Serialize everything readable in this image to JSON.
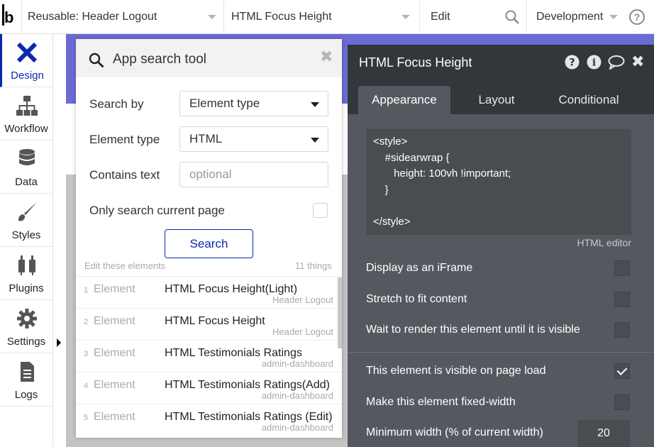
{
  "topbar": {
    "page_selector": "Reusable: Header Logout",
    "element_selector": "HTML Focus Height",
    "mode": "Edit",
    "environment": "Development"
  },
  "sidebar": {
    "items": [
      {
        "label": "Design",
        "icon": "design-icon"
      },
      {
        "label": "Workflow",
        "icon": "workflow-icon"
      },
      {
        "label": "Data",
        "icon": "database-icon"
      },
      {
        "label": "Styles",
        "icon": "brush-icon"
      },
      {
        "label": "Plugins",
        "icon": "plug-icon"
      },
      {
        "label": "Settings",
        "icon": "gear-icon"
      },
      {
        "label": "Logs",
        "icon": "document-icon"
      }
    ]
  },
  "search_tool": {
    "title": "App search tool",
    "search_by_label": "Search by",
    "search_by_value": "Element type",
    "element_type_label": "Element type",
    "element_type_value": "HTML",
    "contains_text_label": "Contains text",
    "contains_text_placeholder": "optional",
    "only_current_label": "Only search current page",
    "search_button": "Search",
    "edit_these": "Edit these elements",
    "count": "11 things",
    "results": [
      {
        "num": "1",
        "kind": "Element",
        "name": "HTML Focus Height(Light)",
        "page": "Header Logout"
      },
      {
        "num": "2",
        "kind": "Element",
        "name": "HTML Focus Height",
        "page": "Header Logout"
      },
      {
        "num": "3",
        "kind": "Element",
        "name": "HTML Testimonials Ratings",
        "page": "admin-dashboard"
      },
      {
        "num": "4",
        "kind": "Element",
        "name": "HTML Testimonials Ratings(Add)",
        "page": "admin-dashboard"
      },
      {
        "num": "5",
        "kind": "Element",
        "name": "HTML Testimonials Ratings (Edit)",
        "page": "admin-dashboard"
      }
    ]
  },
  "property_editor": {
    "title": "HTML Focus Height",
    "tabs": [
      "Appearance",
      "Layout",
      "Conditional"
    ],
    "code_lines": [
      "<style>",
      "    #sidearwrap {",
      "       height: 100vh !important;",
      "    }",
      "",
      "</style>"
    ],
    "code_label": "HTML editor",
    "options": [
      {
        "label": "Display as an iFrame",
        "checked": false
      },
      {
        "label": "Stretch to fit content",
        "checked": false
      },
      {
        "label": "Wait to render this element until it is visible",
        "checked": false
      },
      {
        "label": "This element is visible on page load",
        "checked": true
      },
      {
        "label": "Make this element fixed-width",
        "checked": false
      }
    ],
    "min_width_label": "Minimum width (% of current width)",
    "min_width_value": "20"
  },
  "colors": {
    "accent": "#0c29ab",
    "panel_dark": "#32373c",
    "panel_body": "#54595f",
    "canvas_header": "#6b6bd6"
  }
}
